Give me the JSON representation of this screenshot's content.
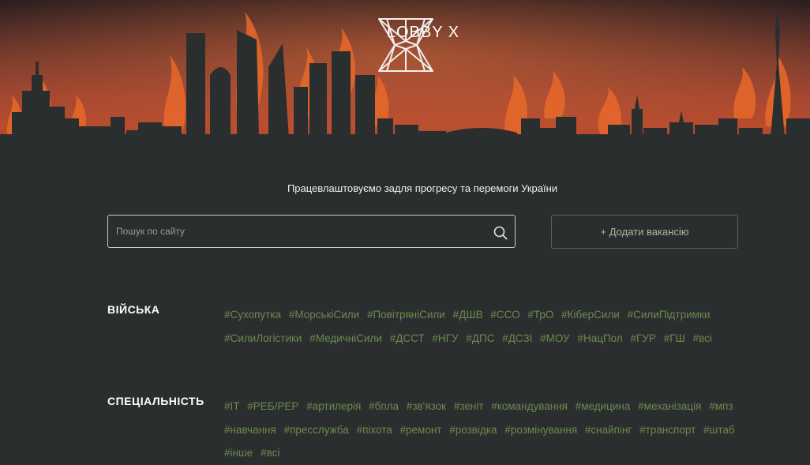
{
  "header": {
    "logo_text": "LOBBY X",
    "colors": {
      "accent_green": "#6b8a4e",
      "fire": "#c0462b",
      "background": "#2b2e2f"
    }
  },
  "tagline": "Працевлаштовуємо задля прогресу та перемоги України",
  "search": {
    "placeholder": "Пошук по сайту",
    "value": "",
    "icon": "search-icon"
  },
  "add_button": {
    "label": "+ Додати вакансію"
  },
  "sections": [
    {
      "label": "ВІЙСЬКА",
      "tags": [
        "#Сухопутка",
        "#МорськіСили",
        "#ПовітряніСили",
        "#ДШВ",
        "#ССО",
        "#ТрО",
        "#КіберСили",
        "#СилиПідтримки",
        "#СилиЛогістики",
        "#МедичніСили",
        "#ДССТ",
        "#НГУ",
        "#ДПС",
        "#ДСЗІ",
        "#МОУ",
        "#НацПол",
        "#ГУР",
        "#ГШ",
        "#всі"
      ]
    },
    {
      "label": "СПЕЦІАЛЬНІСТЬ",
      "tags": [
        "#IT",
        "#РЕБ/РЕР",
        "#артилерія",
        "#бпла",
        "#зв'язок",
        "#зеніт",
        "#командування",
        "#медицина",
        "#механізація",
        "#мпз",
        "#навчання",
        "#пресслужба",
        "#піхота",
        "#ремонт",
        "#розвідка",
        "#розмінування",
        "#снайпінг",
        "#транспорт",
        "#штаб",
        "#інше",
        "#всі"
      ]
    }
  ]
}
